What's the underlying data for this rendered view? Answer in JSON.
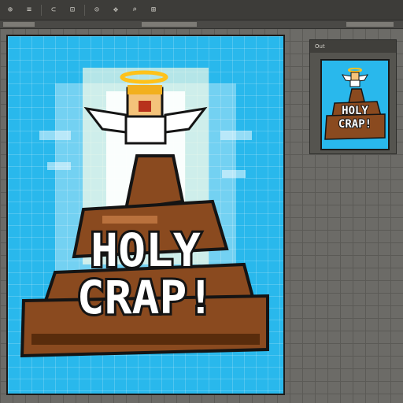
{
  "toolbar": {
    "items": [
      {
        "label": "⊕",
        "icon": "add-icon"
      },
      {
        "label": "≡",
        "icon": "menu-icon"
      },
      {
        "label": "⊂",
        "icon": "lasso-icon"
      },
      {
        "label": "⊡",
        "icon": "select-icon"
      },
      {
        "label": "⊙",
        "icon": "eye-icon"
      },
      {
        "label": "✥",
        "icon": "move-icon"
      },
      {
        "label": "⌕",
        "icon": "search-icon"
      },
      {
        "label": "⊞",
        "icon": "grid-icon"
      }
    ]
  },
  "artwork": {
    "line1": "HOLY",
    "line2": "CRAP!",
    "colors": {
      "sky": "#29b8ec",
      "poop": "#8a4a1f",
      "poop_dark": "#4c2408",
      "poop_light": "#c47b45",
      "halo": "#ffc21a",
      "text": "#ffffff",
      "outline": "#141414"
    }
  },
  "preview": {
    "label": "Out"
  }
}
